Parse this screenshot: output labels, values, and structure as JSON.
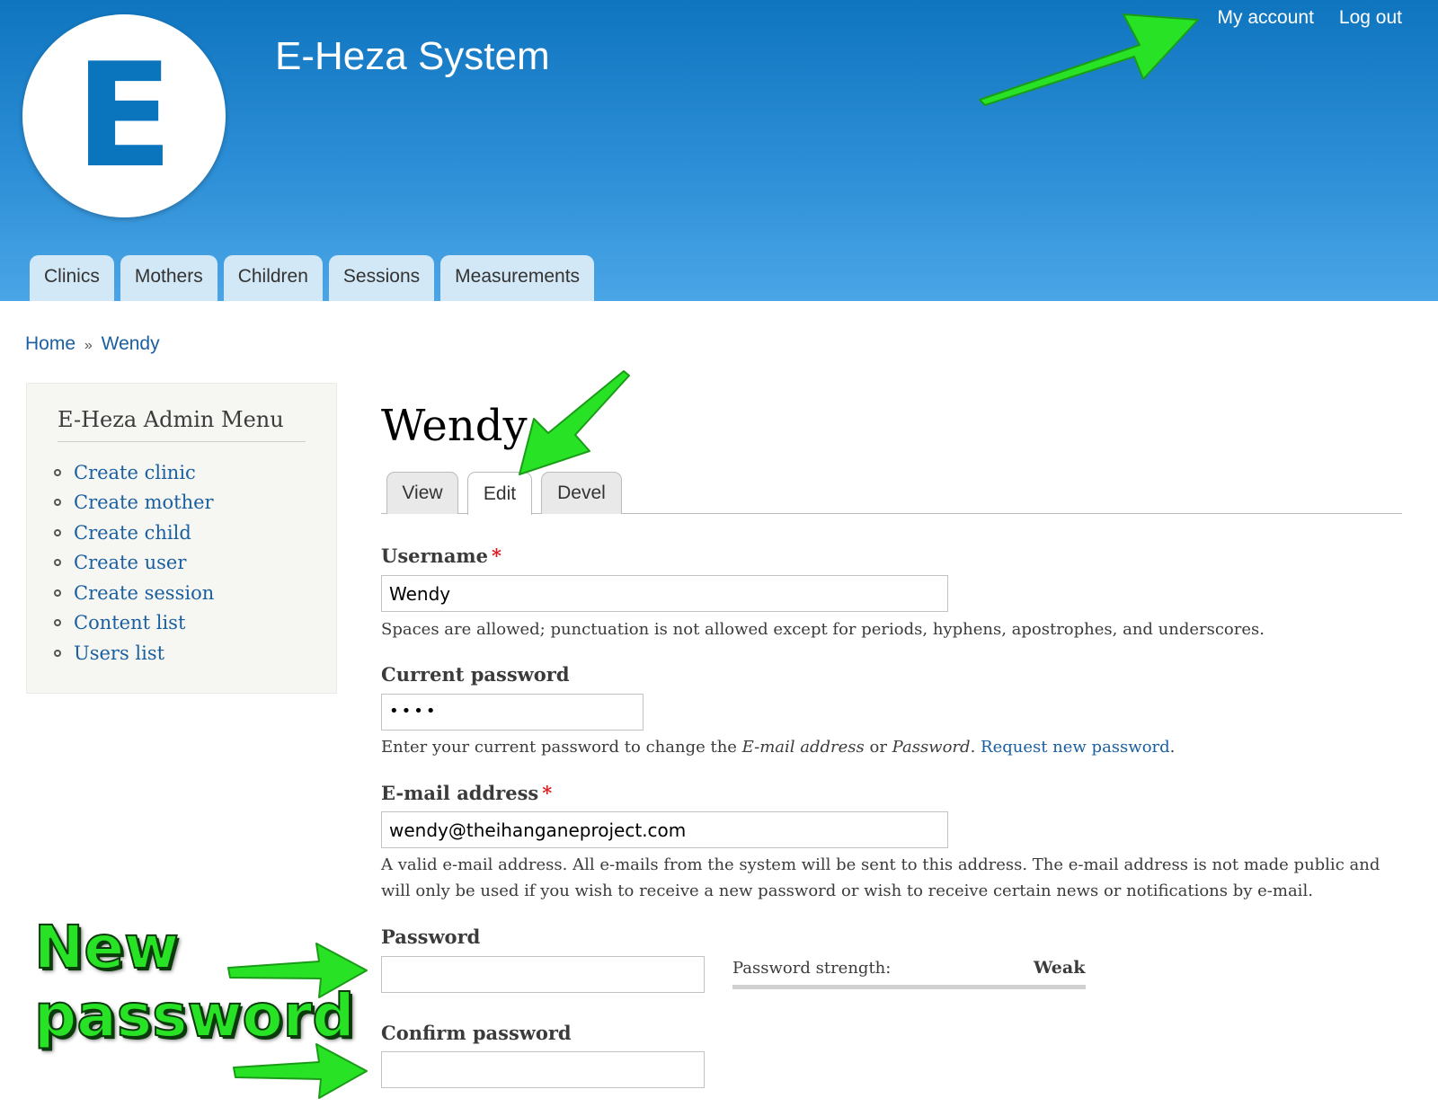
{
  "header": {
    "logo_letter": "E",
    "site_name": "E-Heza System",
    "secondary_menu": [
      "My account",
      "Log out"
    ],
    "main_menu": [
      "Clinics",
      "Mothers",
      "Children",
      "Sessions",
      "Measurements"
    ]
  },
  "breadcrumb": {
    "home": "Home",
    "separator": "»",
    "current": "Wendy"
  },
  "sidebar": {
    "title": "E-Heza Admin Menu",
    "items": [
      "Create clinic",
      "Create mother",
      "Create child",
      "Create user",
      "Create session",
      "Content list",
      "Users list"
    ]
  },
  "content": {
    "title": "Wendy",
    "tabs": [
      "View",
      "Edit",
      "Devel"
    ],
    "active_tab": "Edit",
    "username": {
      "label": "Username",
      "required_mark": "*",
      "value": "Wendy",
      "description": "Spaces are allowed; punctuation is not allowed except for periods, hyphens, apostrophes, and underscores."
    },
    "current_password": {
      "label": "Current password",
      "value": "••••",
      "desc_prefix": "Enter your current password to change the ",
      "desc_em1": "E-mail address",
      "desc_mid": " or ",
      "desc_em2": "Password",
      "desc_dot": ". ",
      "desc_link": "Request new password",
      "desc_end": "."
    },
    "email": {
      "label": "E-mail address",
      "required_mark": "*",
      "value": "wendy@theihanganeproject.com",
      "description": "A valid e-mail address. All e-mails from the system will be sent to this address. The e-mail address is not made public and will only be used if you wish to receive a new password or wish to receive certain news or notifications by e-mail."
    },
    "password": {
      "label": "Password",
      "value": "",
      "strength_label": "Password strength:",
      "strength_value": "Weak"
    },
    "confirm_password": {
      "label": "Confirm password",
      "value": ""
    }
  },
  "annotation": {
    "line1": "New",
    "line2": "password",
    "color": "#28e225"
  },
  "colors": {
    "header_top": "#0f75bf",
    "header_bottom": "#4aa5e6",
    "link": "#1a5fa0",
    "required": "#e0191f"
  }
}
